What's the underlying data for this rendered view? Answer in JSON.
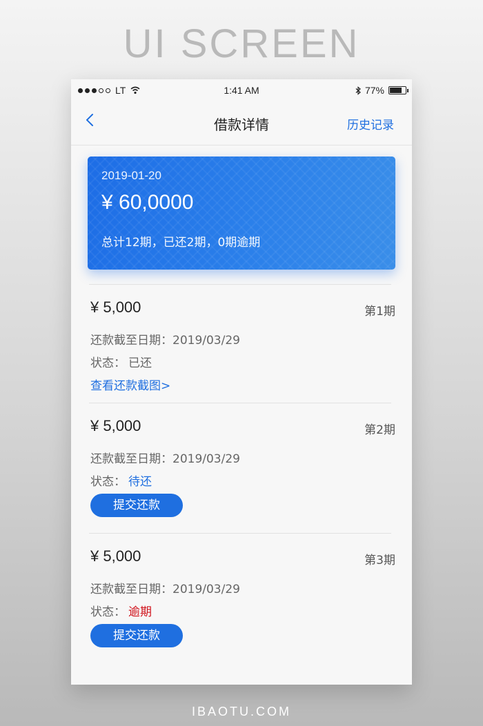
{
  "page": {
    "header": "UI SCREEN",
    "footer": "IBAOTU.COM"
  },
  "status_bar": {
    "carrier": "LT",
    "time": "1:41 AM",
    "battery": "77%",
    "battery_level": 0.77
  },
  "nav": {
    "title": "借款详情",
    "history": "历史记录"
  },
  "card": {
    "date": "2019-01-20",
    "amount": "¥ 60,0000",
    "summary": "总计12期，已还2期，0期逾期"
  },
  "installments": [
    {
      "amount": "¥ 5,000",
      "period": "第1期",
      "due_label": "还款截至日期：",
      "due_date": "2019/03/29",
      "status_label": "状态：",
      "status": "已还",
      "action": "查看还款截图>"
    },
    {
      "amount": "¥ 5,000",
      "period": "第2期",
      "due_label": "还款截至日期：",
      "due_date": "2019/03/29",
      "status_label": "状态：",
      "status": "待还",
      "action": "提交还款"
    },
    {
      "amount": "¥ 5,000",
      "period": "第3期",
      "due_label": "还款截至日期：",
      "due_date": "2019/03/29",
      "status_label": "状态：",
      "status": "逾期",
      "action": "提交还款"
    }
  ],
  "colors": {
    "accent": "#1f6fe0",
    "overdue": "#d0121b",
    "card_start": "#1d6de6",
    "card_end": "#3a8ee9"
  },
  "icons": {
    "back": "chevron-left-icon",
    "wifi": "wifi-icon",
    "bluetooth": "bluetooth-icon",
    "battery": "battery-icon"
  }
}
